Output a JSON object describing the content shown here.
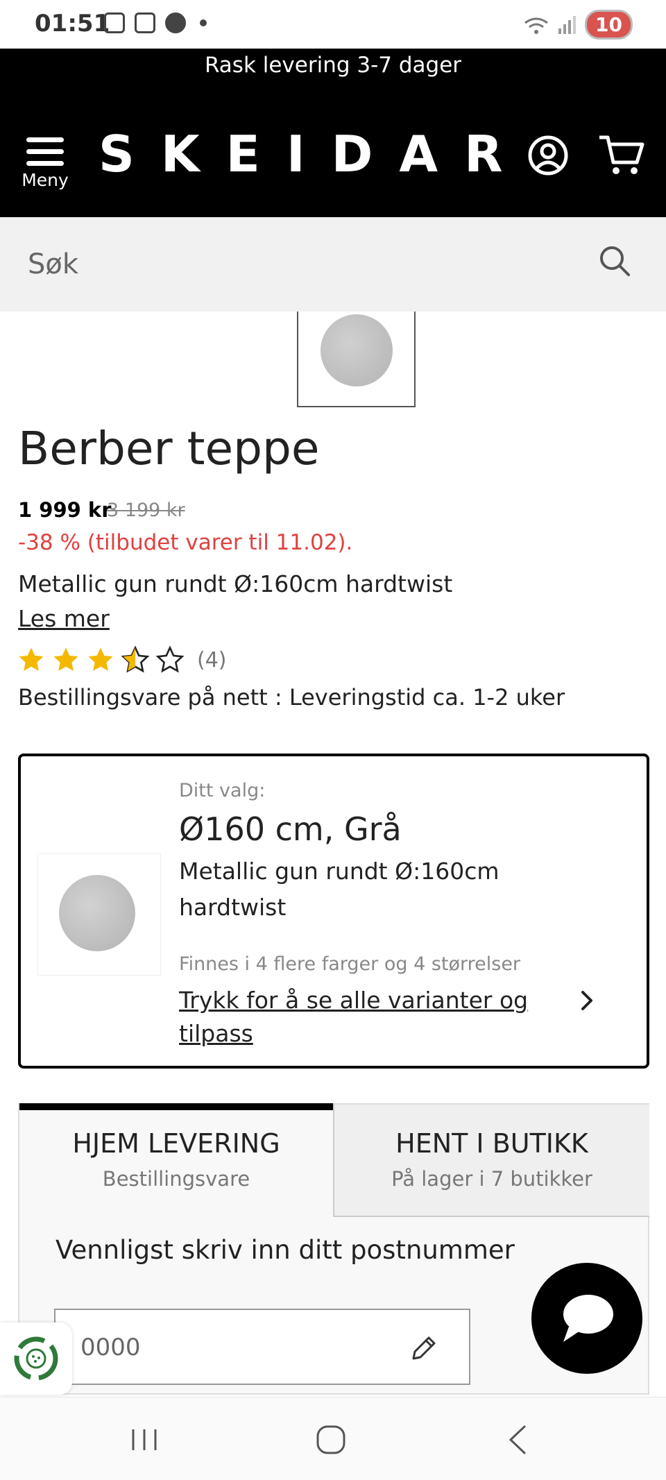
{
  "status_bar": {
    "time": "01:51",
    "battery": "10"
  },
  "promo_banner": {
    "text": "Rask levering 3-7 dager"
  },
  "header": {
    "menu_label": "Meny",
    "logo": "SKEIDAR",
    "icons": [
      "menu-icon",
      "account-icon",
      "cart-icon"
    ]
  },
  "search": {
    "placeholder": "Søk",
    "icon": "search-icon"
  },
  "product": {
    "title": "Berber teppe",
    "price": "1 999 kr",
    "old_price": "3 199 kr",
    "discount": "-38 % (tilbudet varer til 11.02).",
    "description": "Metallic gun rundt Ø:160cm hardtwist",
    "read_more": "Les mer",
    "rating": 3.5,
    "rating_max": 5,
    "rating_count": "(4)",
    "availability": "Bestillingsvare på nett : Leveringstid ca. 1-2 uker"
  },
  "variant_card": {
    "label": "Ditt valg:",
    "choice": "Ø160 cm, Grå",
    "description": "Metallic gun rundt Ø:160cm hardtwist",
    "more_variants": "Finnes i 4 flere farger og 4 størrelser",
    "link": "Trykk for å se alle varianter og tilpass"
  },
  "delivery": {
    "tabs": [
      {
        "title": "HJEM LEVERING",
        "subtitle": "Bestillingsvare",
        "active": true
      },
      {
        "title": "HENT I BUTIKK",
        "subtitle": "På lager i 7 butikker",
        "active": false
      }
    ],
    "postal_prompt": "Vennligst skriv inn ditt postnummer",
    "postal_placeholder": "0000"
  },
  "colors": {
    "header_bg": "#000000",
    "discount": "#e04040",
    "star": "#f5b800",
    "search_bg": "#f1f1f1"
  }
}
